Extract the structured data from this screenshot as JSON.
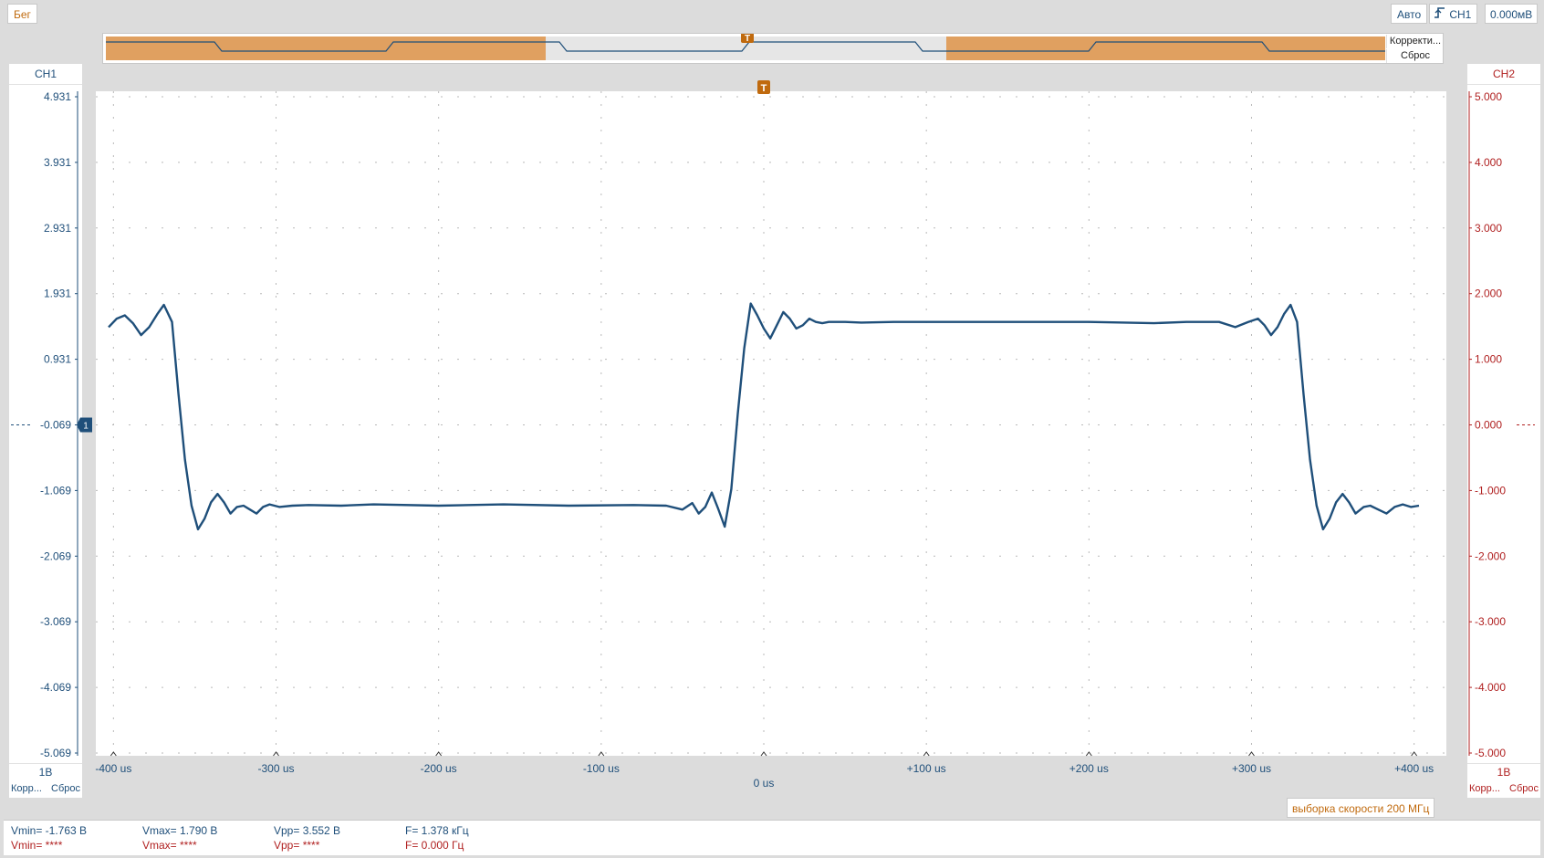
{
  "toolbar": {
    "run_label": "Бег",
    "mode_label": "Авто",
    "trigger_source": "CH1",
    "trigger_level": "0.000мВ"
  },
  "overview": {
    "correction_label": "Корректи...",
    "reset_label": "Сброс",
    "trigger_marker": "T"
  },
  "ch1": {
    "name": "CH1",
    "scale": "1В",
    "footer_left": "Корр...",
    "footer_right": "Сброс",
    "color": "#1f4f7a",
    "ticks": [
      "4.931",
      "3.931",
      "2.931",
      "1.931",
      "0.931",
      "-0.069",
      "-1.069",
      "-2.069",
      "-3.069",
      "-4.069",
      "-5.069"
    ]
  },
  "ch2": {
    "name": "CH2",
    "scale": "1В",
    "footer_left": "Корр...",
    "footer_right": "Сброс",
    "color": "#b02020",
    "ticks": [
      "5.000",
      "4.000",
      "3.000",
      "2.000",
      "1.000",
      "0.000",
      "-1.000",
      "-2.000",
      "-3.000",
      "-4.000",
      "-5.000"
    ]
  },
  "time_axis": {
    "ticks": [
      "-400 us",
      "-300 us",
      "-200 us",
      "-100 us",
      "0 us",
      "+100 us",
      "+200 us",
      "+300 us",
      "+400 us"
    ],
    "center_label": "0 us"
  },
  "trigger_marker": "T",
  "sample_rate": "выборка скорости 200 МГц",
  "measurements": {
    "ch1": {
      "vmin": "Vmin= -1.763 В",
      "vmax": "Vmax= 1.790 В",
      "vpp": "Vpp= 3.552 В",
      "freq": "F= 1.378 кГц"
    },
    "ch2": {
      "vmin": "Vmin= ****",
      "vmax": "Vmax= ****",
      "vpp": "Vpp= ****",
      "freq": "F= 0.000 Гц"
    }
  },
  "chart_data": {
    "type": "line",
    "title": "",
    "xlabel": "",
    "ylabel": "",
    "x_units": "us",
    "y_units": "V",
    "xlim": [
      -403,
      403
    ],
    "ylim": [
      -5.069,
      4.931
    ],
    "grid": true,
    "series": [
      {
        "name": "CH1",
        "x": [
          -403,
          -398,
          -393,
          -388,
          -383,
          -378,
          -373,
          -369,
          -364,
          -360,
          -356,
          -352,
          -348,
          -344,
          -340,
          -336,
          -332,
          -328,
          -324,
          -320,
          -316,
          -312,
          -308,
          -304,
          -298,
          -290,
          -280,
          -260,
          -240,
          -200,
          -160,
          -120,
          -80,
          -60,
          -50,
          -44,
          -40,
          -36,
          -32,
          -28,
          -24,
          -20,
          -16,
          -12,
          -8,
          -4,
          0,
          4,
          8,
          12,
          16,
          20,
          24,
          28,
          32,
          36,
          40,
          44,
          50,
          60,
          80,
          120,
          160,
          200,
          240,
          260,
          280,
          290,
          298,
          304,
          308,
          312,
          316,
          320,
          324,
          328,
          332,
          336,
          340,
          344,
          348,
          352,
          356,
          360,
          364,
          369,
          373,
          378,
          383,
          388,
          393,
          398,
          403
        ],
        "y": [
          1.42,
          1.55,
          1.6,
          1.48,
          1.3,
          1.42,
          1.62,
          1.76,
          1.5,
          0.4,
          -0.6,
          -1.3,
          -1.66,
          -1.5,
          -1.25,
          -1.12,
          -1.25,
          -1.42,
          -1.32,
          -1.3,
          -1.36,
          -1.42,
          -1.32,
          -1.28,
          -1.32,
          -1.3,
          -1.29,
          -1.3,
          -1.28,
          -1.3,
          -1.28,
          -1.3,
          -1.29,
          -1.3,
          -1.36,
          -1.26,
          -1.42,
          -1.32,
          -1.1,
          -1.35,
          -1.62,
          -1.05,
          0.1,
          1.1,
          1.78,
          1.6,
          1.4,
          1.25,
          1.45,
          1.65,
          1.55,
          1.4,
          1.45,
          1.55,
          1.5,
          1.48,
          1.5,
          1.5,
          1.5,
          1.49,
          1.5,
          1.5,
          1.5,
          1.5,
          1.48,
          1.5,
          1.5,
          1.42,
          1.5,
          1.55,
          1.45,
          1.3,
          1.42,
          1.62,
          1.76,
          1.5,
          0.4,
          -0.6,
          -1.3,
          -1.66,
          -1.5,
          -1.25,
          -1.12,
          -1.25,
          -1.42,
          -1.32,
          -1.3,
          -1.36,
          -1.42,
          -1.32,
          -1.28,
          -1.32,
          -1.3
        ]
      }
    ]
  }
}
